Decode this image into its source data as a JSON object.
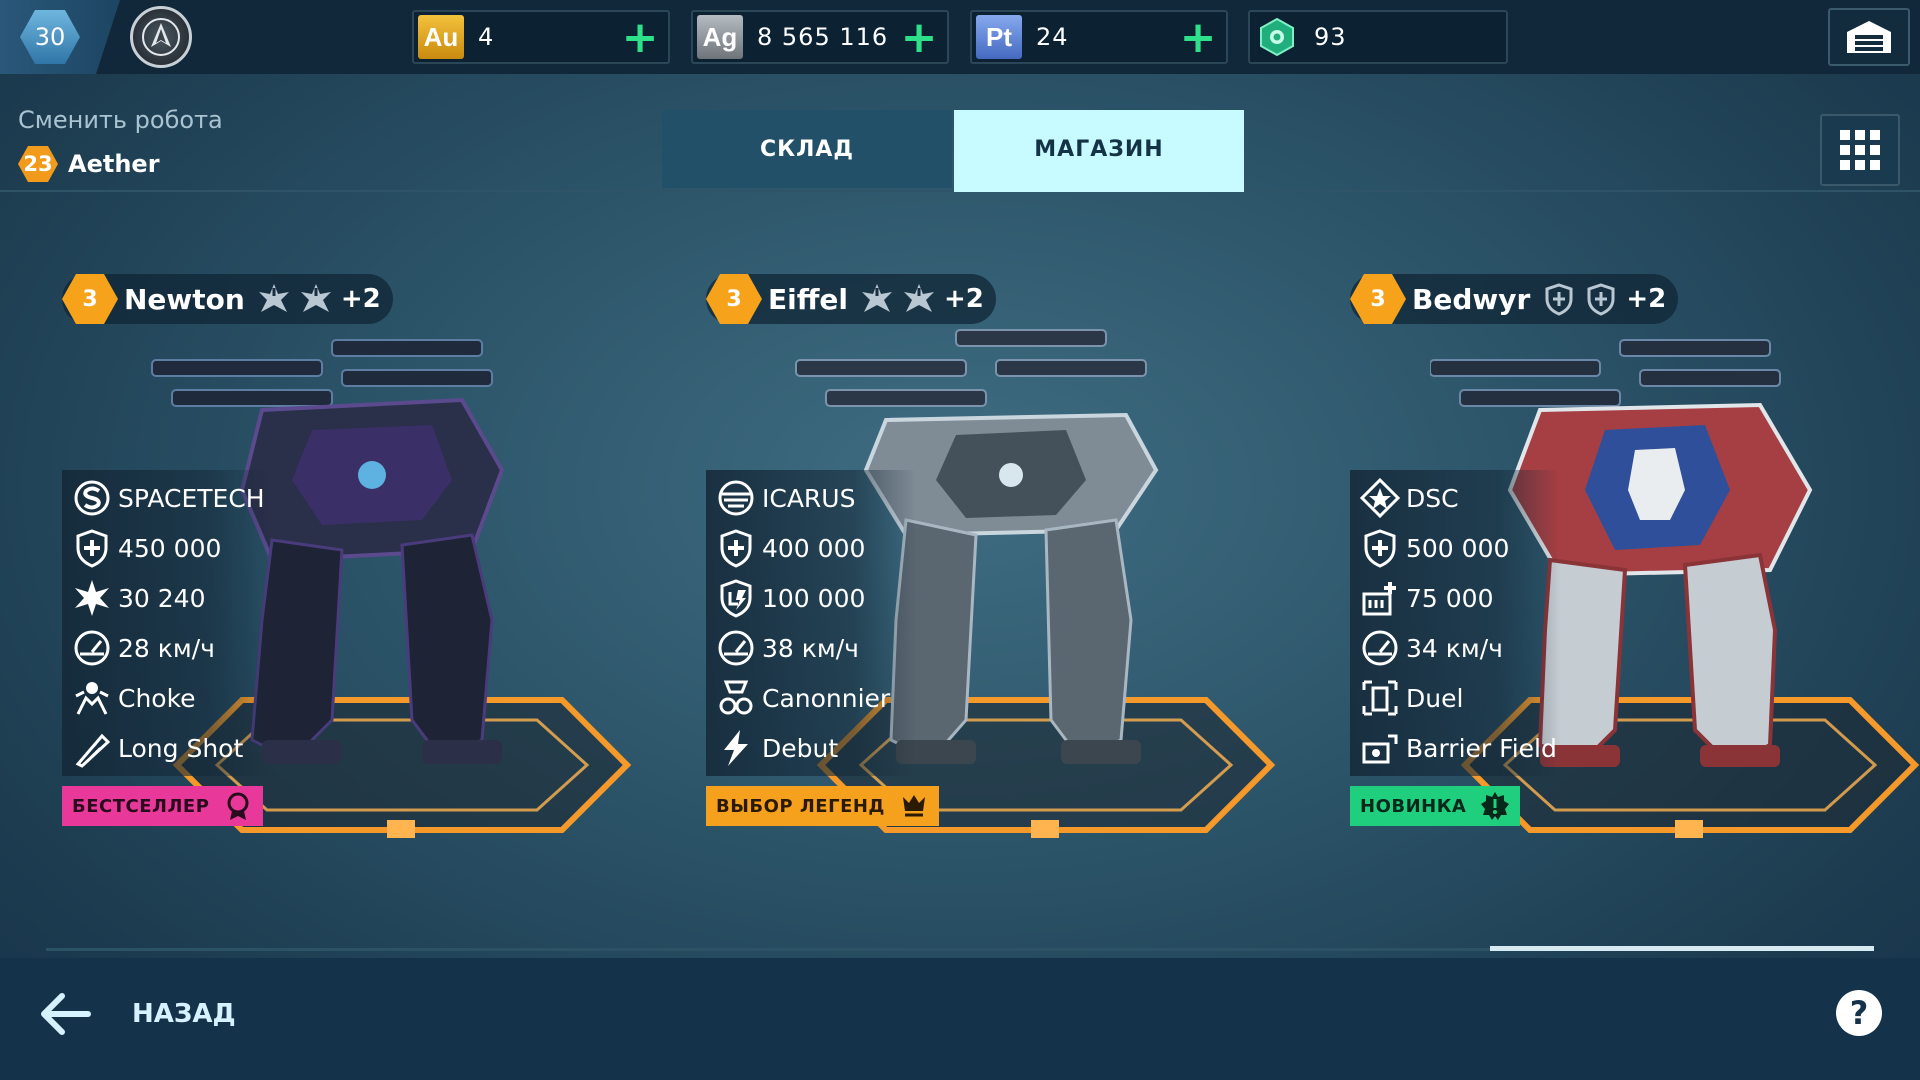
{
  "topbar": {
    "player_level": "30",
    "currencies": [
      {
        "code": "Au",
        "value": "4",
        "color": "#e0a514"
      },
      {
        "code": "Ag",
        "value": "8 565 116",
        "color": "#8d9499"
      },
      {
        "code": "Pt",
        "value": "24",
        "color": "#5f88d8"
      },
      {
        "code": "",
        "value": "93",
        "color": "#21c48e"
      }
    ]
  },
  "header": {
    "change_robot": "Сменить робота",
    "robot_level": "23",
    "robot_name": "Aether"
  },
  "tabs": [
    {
      "label": "СКЛАД",
      "active": false
    },
    {
      "label": "МАГАЗИН",
      "active": true
    }
  ],
  "robots": [
    {
      "level": "3",
      "name": "Newton",
      "extra_slots": "+2",
      "stats": {
        "manufacturer": "SPACETECH",
        "durability": "450 000",
        "damage": "30 240",
        "speed": "28 км/ч",
        "pilot": "Choke",
        "drone": "Long Shot"
      },
      "tag": {
        "label": "БЕСТСЕЛЛЕР",
        "color": "#e8399a"
      },
      "accent": "#5a3d8a"
    },
    {
      "level": "3",
      "name": "Eiffel",
      "extra_slots": "+2",
      "stats": {
        "manufacturer": "ICARUS",
        "durability": "400 000",
        "shield": "100 000",
        "speed": "38 км/ч",
        "pilot": "Canonnier",
        "drone": "Debut"
      },
      "tag": {
        "label": "ВЫБОР ЛЕГЕНД",
        "color": "#f5a11d"
      },
      "accent": "#8a9aa5"
    },
    {
      "level": "3",
      "name": "Bedwyr",
      "extra_slots": "+2",
      "stats": {
        "manufacturer": "DSC",
        "durability": "500 000",
        "barrier": "75 000",
        "speed": "34 км/ч",
        "pilot": "Duel",
        "drone": "Barrier Field"
      },
      "tag": {
        "label": "НОВИНКА",
        "color": "#1fcf7e"
      },
      "accent": "#b44a4a"
    }
  ],
  "footer": {
    "back_label": "НАЗАД",
    "help": "?"
  }
}
